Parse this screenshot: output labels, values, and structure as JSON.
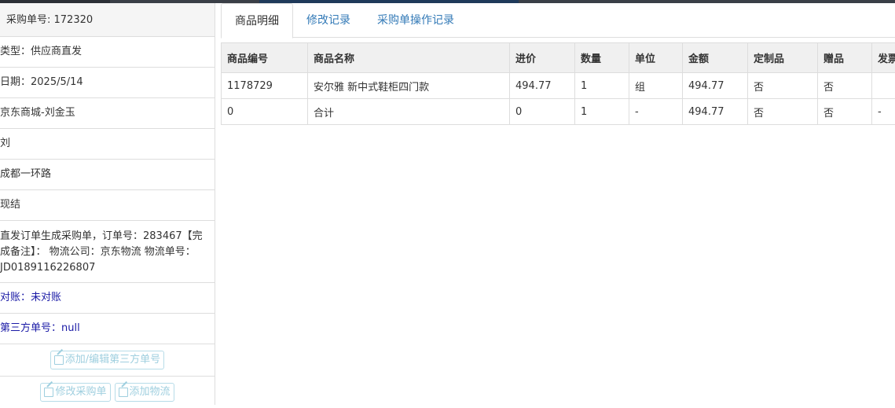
{
  "left_panel": {
    "header": "采购单号: 172320",
    "rows": [
      "类型：供应商直发",
      "日期：2025/5/14",
      "京东商城-刘金玉",
      "刘",
      "成都一环路",
      "现结",
      "直发订单生成采购单，订单号：283467【完成备注】： 物流公司：京东物流 物流单号：JD0189116226807"
    ],
    "reconcile": "对账：未对账",
    "third_party": "第三方单号：null",
    "buttons": {
      "add_edit_third": "添加/编辑第三方单号",
      "modify_po": "修改采购单",
      "add_logistics": "添加物流"
    }
  },
  "tabs": [
    "商品明细",
    "修改记录",
    "采购单操作记录"
  ],
  "table": {
    "headers": [
      "商品编号",
      "商品名称",
      "进价",
      "数量",
      "单位",
      "金额",
      "定制品",
      "赠品",
      "发票"
    ],
    "rows": [
      [
        "1178729",
        "安尔雅 新中式鞋柜四门款",
        "494.77",
        "1",
        "组",
        "494.77",
        "否",
        "否",
        ""
      ],
      [
        "0",
        "合计",
        "0",
        "1",
        "-",
        "494.77",
        "否",
        "否",
        "-"
      ]
    ]
  }
}
